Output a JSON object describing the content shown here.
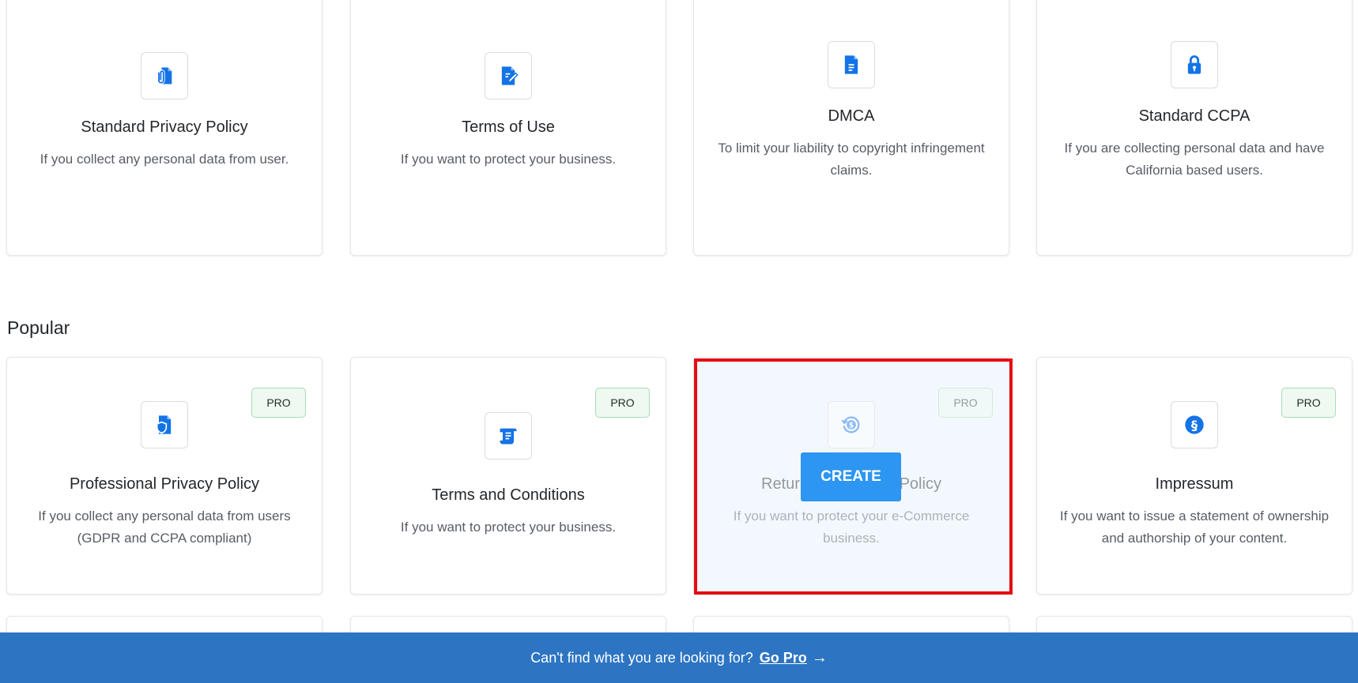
{
  "colors": {
    "accent": "#1473e6",
    "pro_badge_bg": "#eefaf1",
    "pro_badge_border": "#a8dcb6",
    "create_button": "#2d95f2",
    "footer_bg": "#2d75c3",
    "highlight": "#e50d12"
  },
  "top_cards": [
    {
      "icon": "document-clip-icon",
      "title": "Standard Privacy Policy",
      "description": "If you collect any personal data from user."
    },
    {
      "icon": "document-edit-icon",
      "title": "Terms of Use",
      "description": "If you want to protect your business."
    },
    {
      "icon": "document-text-icon",
      "title": "DMCA",
      "description": "To limit your liability to copyright infringement claims."
    },
    {
      "icon": "lock-icon",
      "title": "Standard CCPA",
      "description": "If you are collecting personal data and have California based users."
    }
  ],
  "popular": {
    "heading": "Popular",
    "cards": [
      {
        "icon": "document-shield-icon",
        "title": "Professional Privacy Policy",
        "description": "If you collect any personal data from users (GDPR and CCPA compliant)",
        "badge": "PRO"
      },
      {
        "icon": "scroll-icon",
        "title": "Terms and Conditions",
        "description": "If you want to protect your business.",
        "badge": "PRO"
      },
      {
        "icon": "refund-dollar-icon",
        "title": "Return and Refund Policy",
        "description": "If you want to protect your e-Commerce business.",
        "badge": "PRO",
        "hovered": true,
        "button": "CREATE"
      },
      {
        "icon": "section-sign-icon",
        "title": "Impressum",
        "description": "If you want to issue a statement of ownership and authorship of your content.",
        "badge": "PRO"
      }
    ]
  },
  "footer": {
    "text": "Can't find what you are looking for?",
    "link": "Go Pro",
    "arrow": "→"
  }
}
